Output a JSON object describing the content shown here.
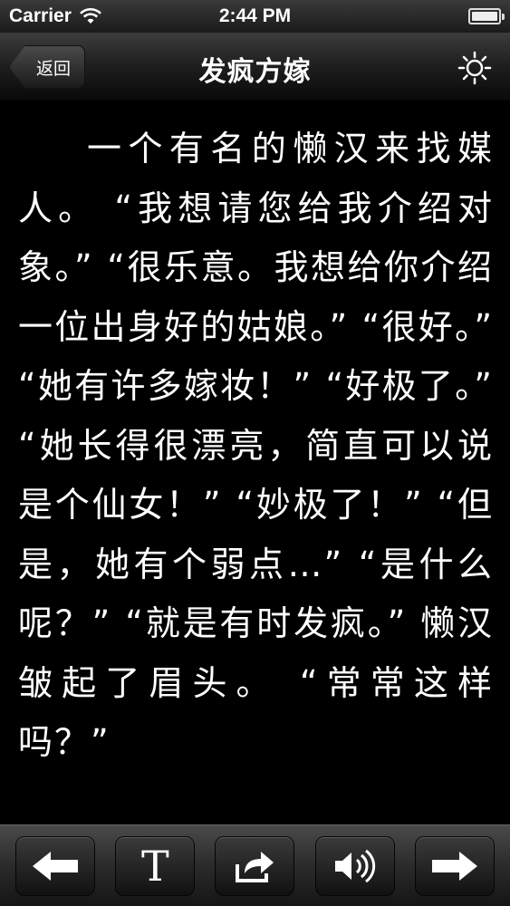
{
  "status_bar": {
    "carrier": "Carrier",
    "time": "2:44 PM",
    "wifi_icon": "wifi-icon",
    "battery_icon": "battery-icon"
  },
  "nav": {
    "back_label": "返回",
    "title": "发疯方嫁",
    "brightness_icon": "sun-icon"
  },
  "content": {
    "text": "一个有名的懒汉来找媒人。 “我想请您给我介绍对象。” “很乐意。我想给你介绍一位出身好的姑娘。” “很好。” “她有许多嫁妆！” “好极了。” “她长得很漂亮，简直可以说是个仙女！” “妙极了！” “但是，她有个弱点…” “是什么呢？” “就是有时发疯。” 懒汉皱起了眉头。 “常常这样吗？”"
  },
  "toolbar": {
    "prev_icon": "arrow-left-icon",
    "font_label": "T",
    "share_icon": "share-icon",
    "audio_icon": "speaker-icon",
    "next_icon": "arrow-right-icon"
  },
  "colors": {
    "background": "#000000",
    "text": "#ffffff",
    "bar_top": "#3c3c3c",
    "bar_bottom": "#090909"
  }
}
